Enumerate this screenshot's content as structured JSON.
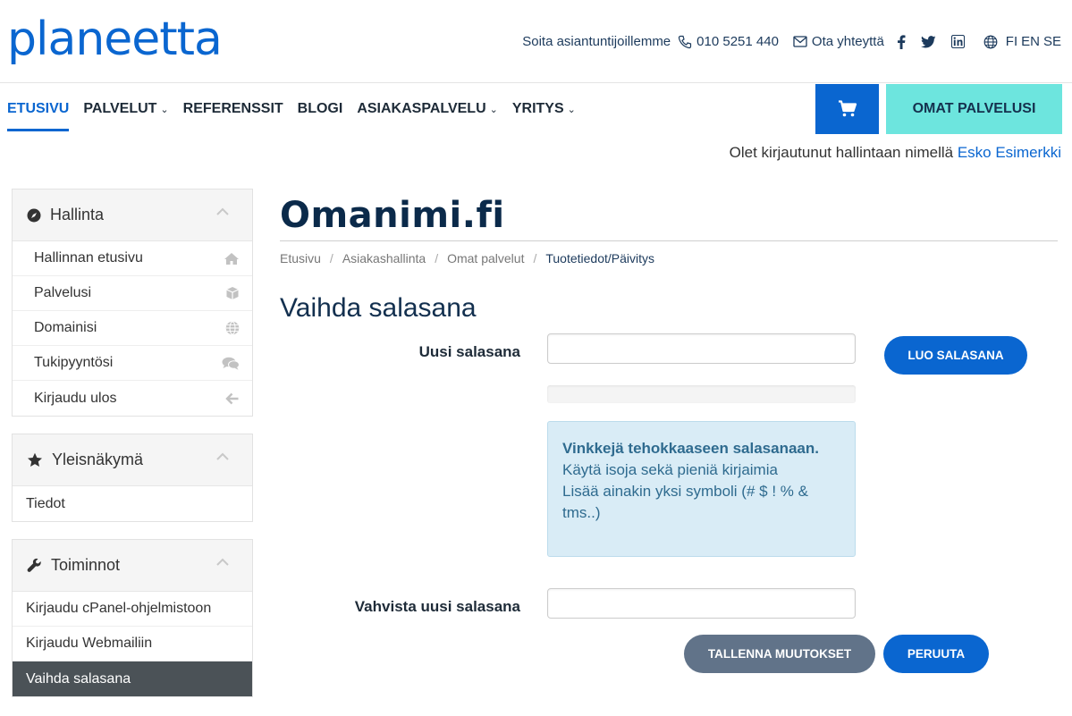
{
  "header": {
    "logo": "planeetta",
    "contact_text": "Soita asiantuntijoillemme",
    "phone": "010 5251 440",
    "contact_link": "Ota yhteyttä",
    "languages": [
      "FI",
      "EN",
      "SE"
    ]
  },
  "nav": {
    "items": [
      {
        "label": "ETUSIVU",
        "dropdown": false,
        "active": true
      },
      {
        "label": "PALVELUT",
        "dropdown": true
      },
      {
        "label": "REFERENSSIT",
        "dropdown": false
      },
      {
        "label": "BLOGI",
        "dropdown": false
      },
      {
        "label": "ASIAKASPALVELU",
        "dropdown": true
      },
      {
        "label": "YRITYS",
        "dropdown": true
      }
    ],
    "omat_label": "OMAT PALVELUSI"
  },
  "login": {
    "prefix": "Olet kirjautunut hallintaan nimellä",
    "user": "Esko Esimerkki"
  },
  "sidebar": {
    "hallinta": {
      "title": "Hallinta",
      "items": [
        "Hallinnan etusivu",
        "Palvelusi",
        "Domainisi",
        "Tukipyyntösi",
        "Kirjaudu ulos"
      ]
    },
    "yleis": {
      "title": "Yleisnäkymä",
      "items": [
        "Tiedot"
      ]
    },
    "toiminnot": {
      "title": "Toiminnot",
      "items": [
        "Kirjaudu cPanel-ohjelmistoon",
        "Kirjaudu Webmailiin",
        "Vaihda salasana"
      ]
    }
  },
  "main": {
    "brand": "Omanimi.fi",
    "breadcrumb": [
      "Etusivu",
      "Asiakashallinta",
      "Omat palvelut",
      "Tuotetiedot/Päivitys"
    ],
    "heading": "Vaihda salasana",
    "new_password_label": "Uusi salasana",
    "new_password_value": "",
    "generate_label": "LUO SALASANA",
    "tip_title": "Vinkkejä tehokkaaseen salasanaan.",
    "tip_line1": "Käytä isoja sekä pieniä kirjaimia",
    "tip_line2": "Lisää ainakin yksi symboli (# $ ! % & tms..)",
    "confirm_label": "Vahvista uusi salasana",
    "confirm_value": "",
    "save_label": "TALLENNA MUUTOKSET",
    "cancel_label": "PERUUTA"
  }
}
